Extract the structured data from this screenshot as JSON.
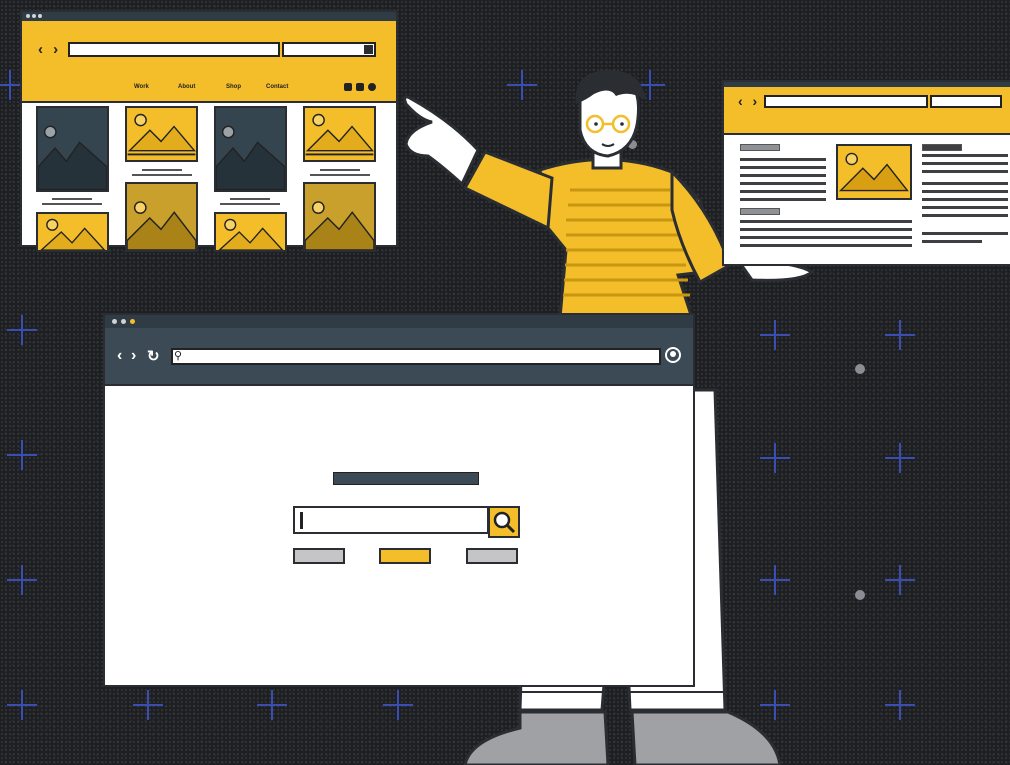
{
  "background": {
    "color": "#1e1f22",
    "sparkle_color": "#3a4db0",
    "dot_color": "#8a8d93"
  },
  "colors": {
    "accent_yellow": "#f3be2a",
    "slate": "#3b4a54",
    "dark_slate": "#2f3c46",
    "outline": "#2a2e33",
    "gray_button": "#c5c5c5",
    "gold": "#c9a02b"
  },
  "gallery_window": {
    "nav_items": [
      "Work",
      "About",
      "Shop",
      "Contact"
    ],
    "icons": [
      "back-arrow-icon",
      "forward-arrow-icon",
      "search-icon",
      "social-icon"
    ]
  },
  "article_window": {
    "icons": [
      "back-arrow-icon",
      "forward-arrow-icon",
      "image-icon"
    ]
  },
  "main_browser": {
    "window_dots": [
      "#cfd3d6",
      "#cfd3d6",
      "#f3be2a"
    ],
    "icons": [
      "back-arrow-icon",
      "forward-arrow-icon",
      "reload-icon",
      "search-icon",
      "profile-icon"
    ],
    "search_button_icon": "magnifier-icon",
    "buttons": [
      {
        "color": "#c5c5c5"
      },
      {
        "color": "#f3be2a"
      },
      {
        "color": "#c5c5c5"
      }
    ]
  },
  "person": {
    "shirt_color": "#f3be2a",
    "pants_color": "#ffffff",
    "shoes_color": "#9fa1a4",
    "hair_color": "#2a2e33"
  }
}
